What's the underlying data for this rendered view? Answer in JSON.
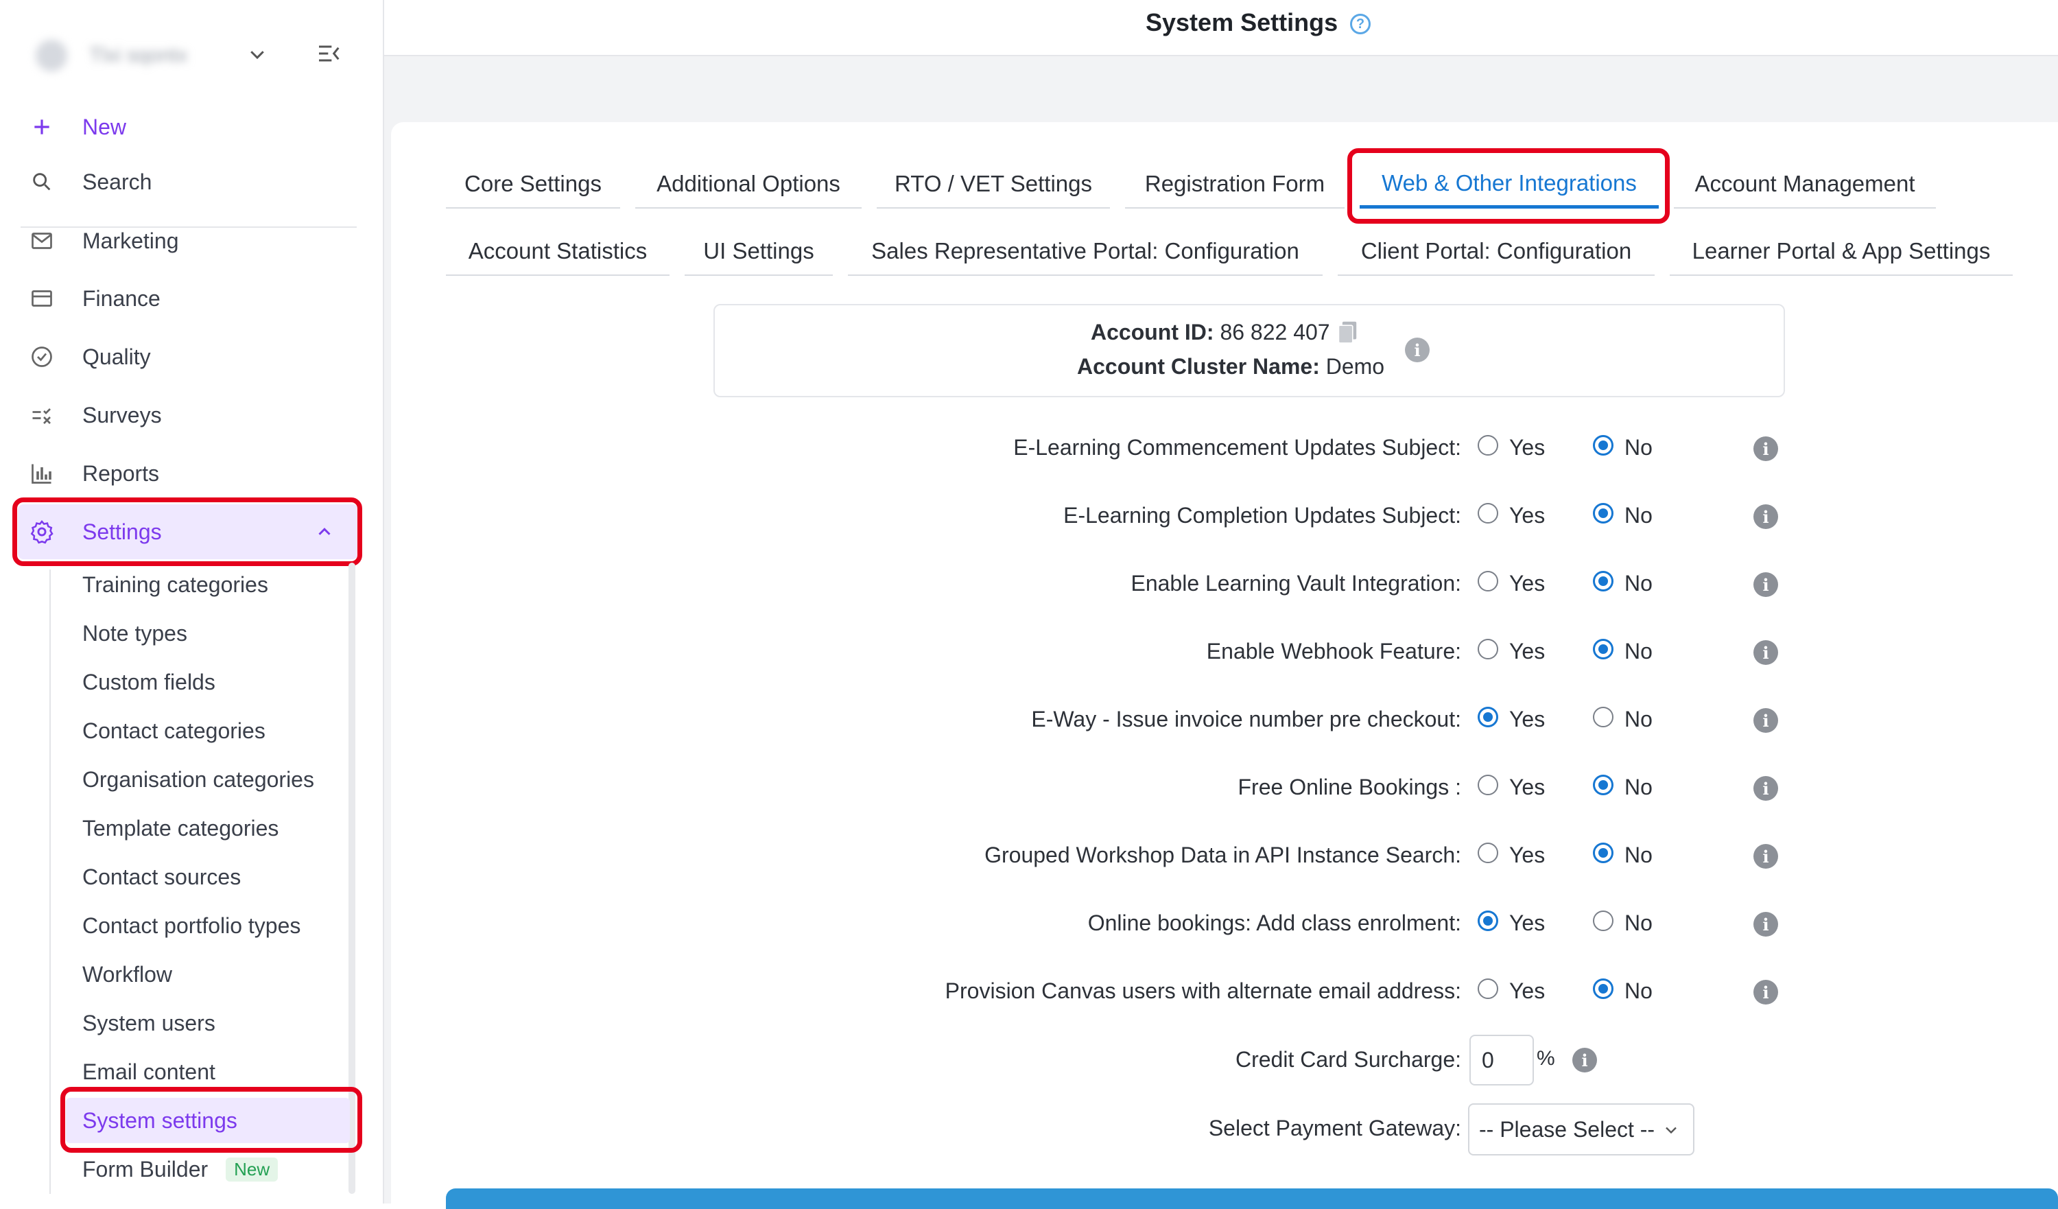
{
  "header": {
    "title": "System Settings",
    "help_icon": "question-circle-icon"
  },
  "sidebar": {
    "account_name": "Tlxi sqontx",
    "new_label": "New",
    "search_label": "Search",
    "items": [
      {
        "label": "Marketing",
        "icon": "mail-icon"
      },
      {
        "label": "Finance",
        "icon": "card-icon"
      },
      {
        "label": "Quality",
        "icon": "check-circle-icon"
      },
      {
        "label": "Surveys",
        "icon": "survey-icon"
      },
      {
        "label": "Reports",
        "icon": "bar-chart-icon"
      }
    ],
    "settings_label": "Settings",
    "sub_items": [
      "Training categories",
      "Note types",
      "Custom fields",
      "Contact categories",
      "Organisation categories",
      "Template categories",
      "Contact sources",
      "Contact portfolio types",
      "Workflow",
      "System users",
      "Email content",
      "System settings",
      "Form Builder"
    ],
    "form_builder_badge": "New"
  },
  "tabs": {
    "row1": [
      "Core Settings",
      "Additional Options",
      "RTO / VET Settings",
      "Registration Form",
      "Web & Other Integrations",
      "Account Management"
    ],
    "row2": [
      "Account Statistics",
      "UI Settings",
      "Sales Representative Portal: Configuration",
      "Client Portal: Configuration",
      "Learner Portal & App Settings"
    ],
    "active": "Web & Other Integrations"
  },
  "account": {
    "id_label": "Account ID:",
    "id_value": "86 822 407",
    "cluster_label": "Account Cluster Name:",
    "cluster_value": "Demo"
  },
  "settings": [
    {
      "label": "E-Learning Commencement Updates Subject:",
      "value": "No"
    },
    {
      "label": "E-Learning Completion Updates Subject:",
      "value": "No"
    },
    {
      "label": "Enable Learning Vault Integration:",
      "value": "No"
    },
    {
      "label": "Enable Webhook Feature:",
      "value": "No"
    },
    {
      "label": "E-Way - Issue invoice number pre checkout:",
      "value": "Yes"
    },
    {
      "label": "Free Online Bookings :",
      "value": "No"
    },
    {
      "label": "Grouped Workshop Data in API Instance Search:",
      "value": "No"
    },
    {
      "label": "Online bookings: Add class enrolment:",
      "value": "Yes"
    },
    {
      "label": "Provision Canvas users with alternate email address:",
      "value": "No"
    }
  ],
  "options": {
    "yes": "Yes",
    "no": "No"
  },
  "surcharge": {
    "label": "Credit Card Surcharge:",
    "value": "0",
    "unit": "%"
  },
  "gateway": {
    "label": "Select Payment Gateway:",
    "placeholder": "-- Please Select --"
  },
  "colors": {
    "accent": "#1677d2",
    "brand": "#7c3aed",
    "highlight": "#e5001c"
  }
}
